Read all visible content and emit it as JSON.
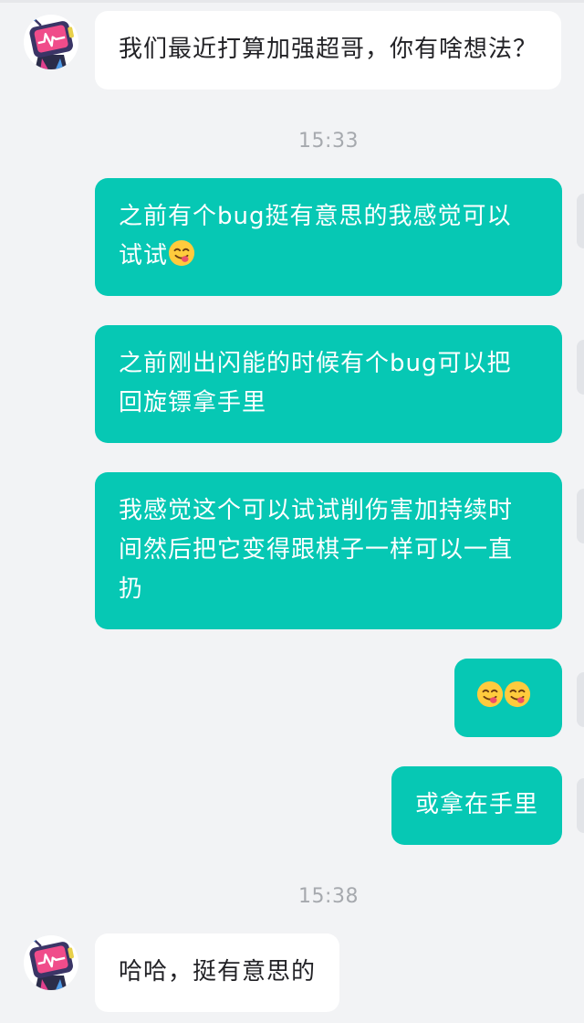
{
  "conversation": {
    "messages": [
      {
        "id": "m1",
        "direction": "in",
        "text": "我们最近打算加强超哥，你有啥想法？"
      },
      {
        "id": "m2",
        "direction": "out",
        "text": "之前有个bug挺有意思的我感觉可以",
        "line2": "试试"
      },
      {
        "id": "m3",
        "direction": "out",
        "text": "之前刚出闪能的时候有个bug可以把",
        "line2": "回旋镖拿手里"
      },
      {
        "id": "m4",
        "direction": "out",
        "text": "我感觉这个可以试试削伤害加持续时",
        "line2": "间然后把它变得跟棋子一样可以一直",
        "line3": "扔"
      },
      {
        "id": "m5",
        "direction": "out",
        "text": "",
        "emoji_count": 2
      },
      {
        "id": "m6",
        "direction": "out",
        "text": "或拿在手里"
      },
      {
        "id": "m7",
        "direction": "in",
        "text": "哈哈，挺有意思的"
      }
    ],
    "timestamps": [
      "15:33",
      "15:38"
    ]
  },
  "theme": {
    "outgoing_bubble": "#06c8b4",
    "incoming_bubble": "#ffffff",
    "background": "#f2f3f5"
  },
  "icons": {
    "avatar": "tv-robot-avatar-icon",
    "emoji": "face-savoring-food-emoji-icon"
  }
}
